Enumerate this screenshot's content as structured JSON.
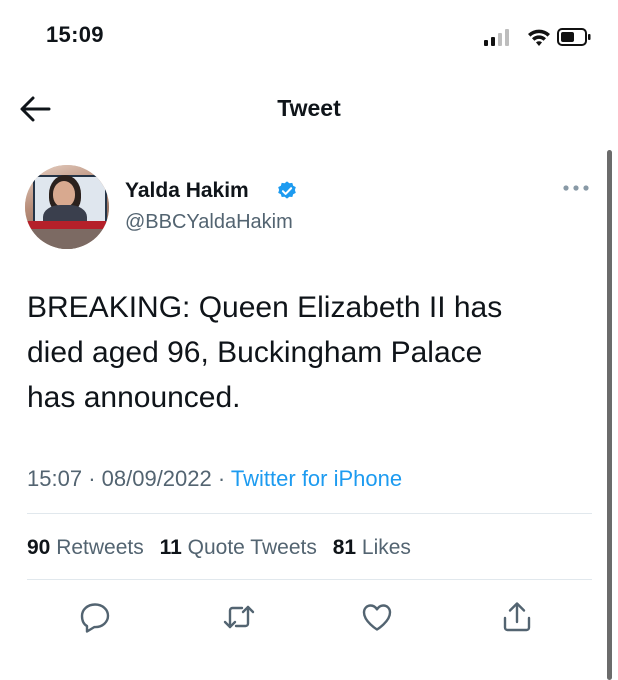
{
  "status_bar": {
    "time": "15:09"
  },
  "header": {
    "title": "Tweet"
  },
  "author": {
    "name": "Yalda Hakim",
    "handle": "@BBCYaldaHakim"
  },
  "tweet": {
    "lines": [
      "BREAKING: Queen Elizabeth II has",
      "died aged 96, Buckingham Palace",
      "has announced."
    ],
    "time": "15:07",
    "date": "08/09/2022",
    "source": "Twitter for iPhone"
  },
  "stats": {
    "retweets_count": "90",
    "retweets_label": "Retweets",
    "quotes_count": "11",
    "quotes_label": "Quote Tweets",
    "likes_count": "81",
    "likes_label": "Likes"
  },
  "icons": [
    "back-arrow-icon",
    "verified-badge-icon",
    "more-options-icon",
    "reply-icon",
    "retweet-icon",
    "like-icon",
    "share-icon",
    "signal-icon",
    "wifi-icon",
    "battery-icon"
  ],
  "colors": {
    "accent": "#1d9bf0",
    "secondary_text": "#536471",
    "text": "#0f1419"
  }
}
